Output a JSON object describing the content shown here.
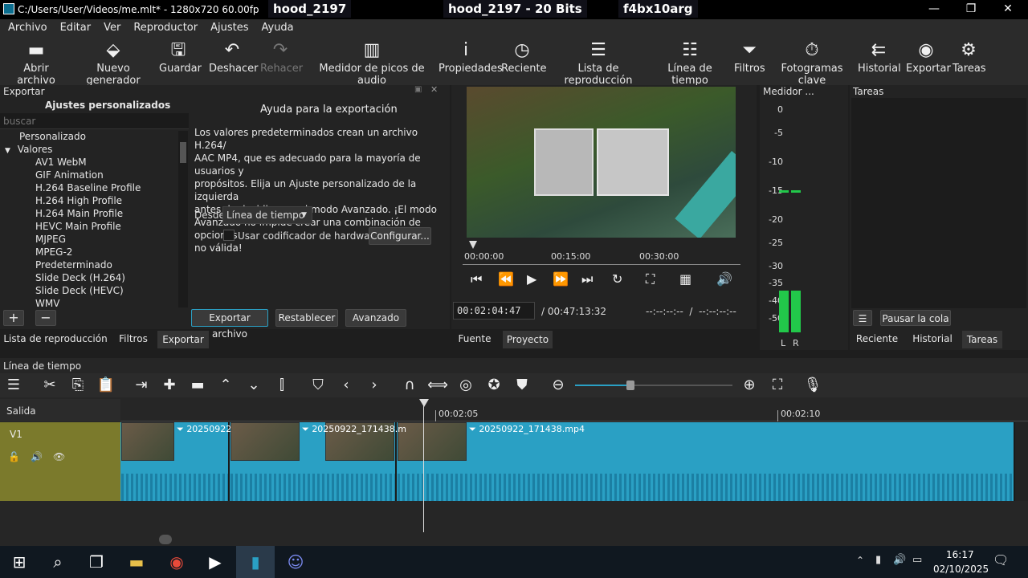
{
  "titlebar": {
    "title": "C:/Users/User/Videos/me.mlt* - 1280x720 60.00fps 2ch - S",
    "tabs": [
      "hood_2197",
      "hood_2197 - 20 Bits",
      "f4bx10arg"
    ],
    "minimize": "—",
    "maximize": "❐",
    "close": "✕"
  },
  "menu": [
    "Archivo",
    "Editar",
    "Ver",
    "Reproductor",
    "Ajustes",
    "Ayuda"
  ],
  "toolbar": [
    {
      "label": "Abrir archivo",
      "icon": "folder-icon",
      "glyph": "▬"
    },
    {
      "label": "Nuevo generador",
      "icon": "generator-icon",
      "glyph": "⬙"
    },
    {
      "label": "Guardar",
      "icon": "save-icon",
      "glyph": "🖫"
    },
    {
      "label": "Deshacer",
      "icon": "undo-icon",
      "glyph": "↶"
    },
    {
      "label": "Rehacer",
      "icon": "redo-icon",
      "glyph": "↷"
    },
    {
      "label": "Medidor de picos de audio",
      "icon": "audio-peak-icon",
      "glyph": "▥"
    },
    {
      "label": "Propiedades",
      "icon": "info-icon",
      "glyph": "i"
    },
    {
      "label": "Reciente",
      "icon": "clock-icon",
      "glyph": "◷"
    },
    {
      "label": "Lista de reproducción",
      "icon": "list-icon",
      "glyph": "☰"
    },
    {
      "label": "Línea de tiempo",
      "icon": "timeline-icon",
      "glyph": "☷"
    },
    {
      "label": "Filtros",
      "icon": "filter-icon",
      "glyph": "⏷"
    },
    {
      "label": "Fotogramas clave",
      "icon": "stopwatch-icon",
      "glyph": "⏱"
    },
    {
      "label": "Historial",
      "icon": "history-icon",
      "glyph": "⇇"
    },
    {
      "label": "Exportar",
      "icon": "export-icon",
      "glyph": "◉"
    },
    {
      "label": "Tareas",
      "icon": "gear-icon",
      "glyph": "⚙"
    }
  ],
  "export_panel": {
    "title": "Exportar",
    "presets_header": "Ajustes personalizados",
    "search_placeholder": "buscar",
    "tree": [
      "Personalizado",
      "Valores",
      "AV1 WebM",
      "GIF Animation",
      "H.264 Baseline Profile",
      "H.264 High Profile",
      "H.264 Main Profile",
      "HEVC Main Profile",
      "MJPEG",
      "MPEG-2",
      "Predeterminado",
      "Slide Deck (H.264)",
      "Slide Deck (HEVC)",
      "WMV"
    ],
    "add": "+",
    "remove": "−",
    "help_title": "Ayuda para la exportación",
    "help_lines": [
      "Los valores predeterminados crean un archivo H.264/",
      "AAC MP4, que es adecuado para la mayoría de usuarios y",
      "propósitos. Elija un Ajuste personalizado de la izquierda",
      "antes de decidir usar el modo Avanzado. ¡El modo",
      "Avanzado no impide crear una combinación de opciones",
      "no válida!"
    ],
    "from_label": "Desde",
    "from_value": "Línea de tiempo",
    "hw_label": "Usar codificador de hardware",
    "configure": "Configurar...",
    "export_file": "Exportar archivo",
    "reset": "Restablecer",
    "advanced": "Avanzado"
  },
  "left_tabs": [
    "Lista de reproducción",
    "Filtros",
    "Exportar"
  ],
  "player": {
    "ruler": [
      "00:00:00",
      "00:15:00",
      "00:30:00"
    ],
    "timecode": "00:02:04:47",
    "duration": "00:47:13:32",
    "in_out": "--:--:--:--  /  --:--:--:--",
    "tabs": [
      "Fuente",
      "Proyecto"
    ]
  },
  "meter": {
    "title": "Medidor ...",
    "scale": [
      "0",
      "-5",
      "-10",
      "-15",
      "-20",
      "-25",
      "-30",
      "-35",
      "-40",
      "-50"
    ],
    "left": "L",
    "right": "R"
  },
  "jobs": {
    "title": "Tareas",
    "pause": "Pausar la cola",
    "tabs": [
      "Reciente",
      "Historial",
      "Tareas"
    ]
  },
  "timeline": {
    "title": "Línea de tiempo",
    "output": "Salida",
    "track": "V1",
    "ruler": [
      "00:02:05",
      "00:02:10"
    ],
    "clips": [
      "20250922",
      "20250922_171438.m",
      "20250922_171438.mp4"
    ],
    "zoom_level": 0.35
  },
  "taskbar": {
    "time": "16:17",
    "date": "02/10/2025"
  },
  "colors": {
    "accent": "#2aa0c4",
    "track": "#7b7a2c",
    "meter": "#22c84a"
  }
}
